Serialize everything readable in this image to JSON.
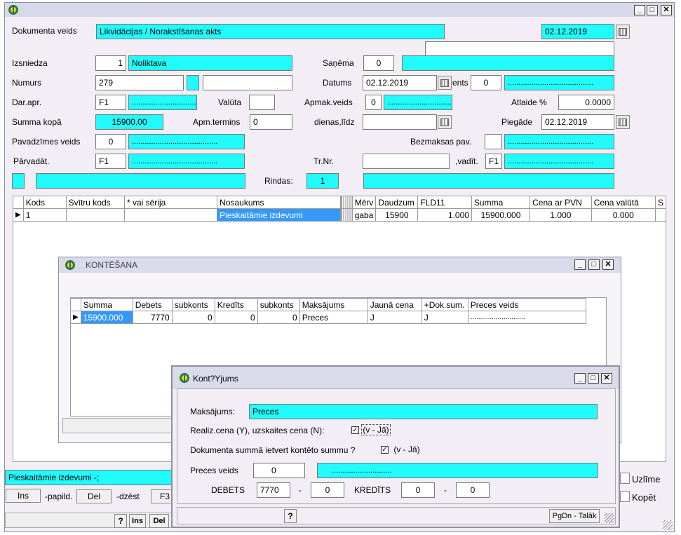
{
  "main": {
    "dokumenta_veids_label": "Dokumenta veids",
    "dokumenta_veids": "Likvidācijas / Norakstīšanas akts",
    "doc_date": "02.12.2019",
    "izsniedza_label": "Izsniedza",
    "izsniedza_code": "1",
    "izsniedza_name": "Noliktava",
    "sanema_label": "Saņēma",
    "sanema_code": "0",
    "numurs_label": "Numurs",
    "numurs": "279",
    "datums_label": "Datums",
    "datums": "02.12.2019",
    "ents_label": "ents",
    "ents_code": "0",
    "dots": "........................................",
    "darapr_label": "Dar.apr.",
    "darapr_code": "F1",
    "valuta_label": "Valūta",
    "apmak_label": "Apmak.veids",
    "apmak_code": "0",
    "atlaide_label": "Atlaide %",
    "atlaide": "0.0000",
    "summa_label": "Summa kopā",
    "summa": "15900.00",
    "apmterm_label": "Apm.termiņs",
    "apmterm": "0",
    "dienas_label": "dienas,līdz",
    "piegade_label": "Piegāde",
    "piegade": "02.12.2019",
    "pavveids_label": "Pavadzīmes veids",
    "pavveids_code": "0",
    "bezmaksas_label": "Bezmaksas pav.",
    "parvad_label": "Pārvadāt.",
    "parvad_code": "F1",
    "trnr_label": "Tr.Nr.",
    "vadit_label": ",vadīt.",
    "vadit_code": "F1",
    "rindas_label": "Rindas:",
    "rindas": "1"
  },
  "grid": {
    "headers": [
      "Kods",
      "Svītru kods",
      "* vai sērija",
      "Nosaukums",
      "Mērv",
      "Daudzum",
      "FLD11",
      "Summa",
      "Cena ar PVN",
      "Cena valūtā",
      "S"
    ],
    "row": {
      "kods": "1",
      "nosaukums": "Pieskaitāmie izdevumi",
      "merv": "gaba",
      "daudz": "15900",
      "fld11": "1.000",
      "summa": "15900.000",
      "cena_pvn": "1.000",
      "cena_val": "0.000"
    }
  },
  "status": {
    "line": "Pieskaitāmie izdevumi  -;",
    "ins": "Ins",
    "papild": "-papild.",
    "del": "Del",
    "dzest": "-dzēst",
    "f3": "F3",
    "uzlime": "Uzlīme",
    "kopet": "Kopēt",
    "q": "?",
    "ins2": "Ins",
    "del2": "Del"
  },
  "kontesana": {
    "title": "KONTĒŠANA",
    "headers": [
      "Summa",
      "Debets",
      "subkonts",
      "Kredīts",
      "subkonts",
      "Maksājums",
      "Jaunā cena",
      "+Dok.sum.",
      "Preces veids"
    ],
    "row": {
      "summa": "15900.000",
      "debets": "7770",
      "sub1": "0",
      "kredits": "0",
      "sub2": "0",
      "maksajums": "Preces",
      "jauna": "J",
      "doksum": "J",
      "preces": "............................"
    }
  },
  "kontejums": {
    "title": "Kont?Yjums",
    "maksajums_label": "Maksājums:",
    "maksajums": "Preces",
    "realiz_label": "Realiz.cena (Y), uzskaites cena (N):",
    "realiz_val": "(v - Jā)",
    "dok_label": "Dokumenta summā ietvert kontēto summu ?",
    "dok_val": "(v - Jā)",
    "preces_label": "Preces veids",
    "preces_code": "0",
    "preces_dots": "............................",
    "debets_label": "DEBETS",
    "debets": "7770",
    "debets_sub": "0",
    "dash": "-",
    "kredits_label": "KREDĪTS",
    "kredits": "0",
    "kredits_sub": "0",
    "q": "?",
    "pgdn": "PgDn - Talāk"
  }
}
